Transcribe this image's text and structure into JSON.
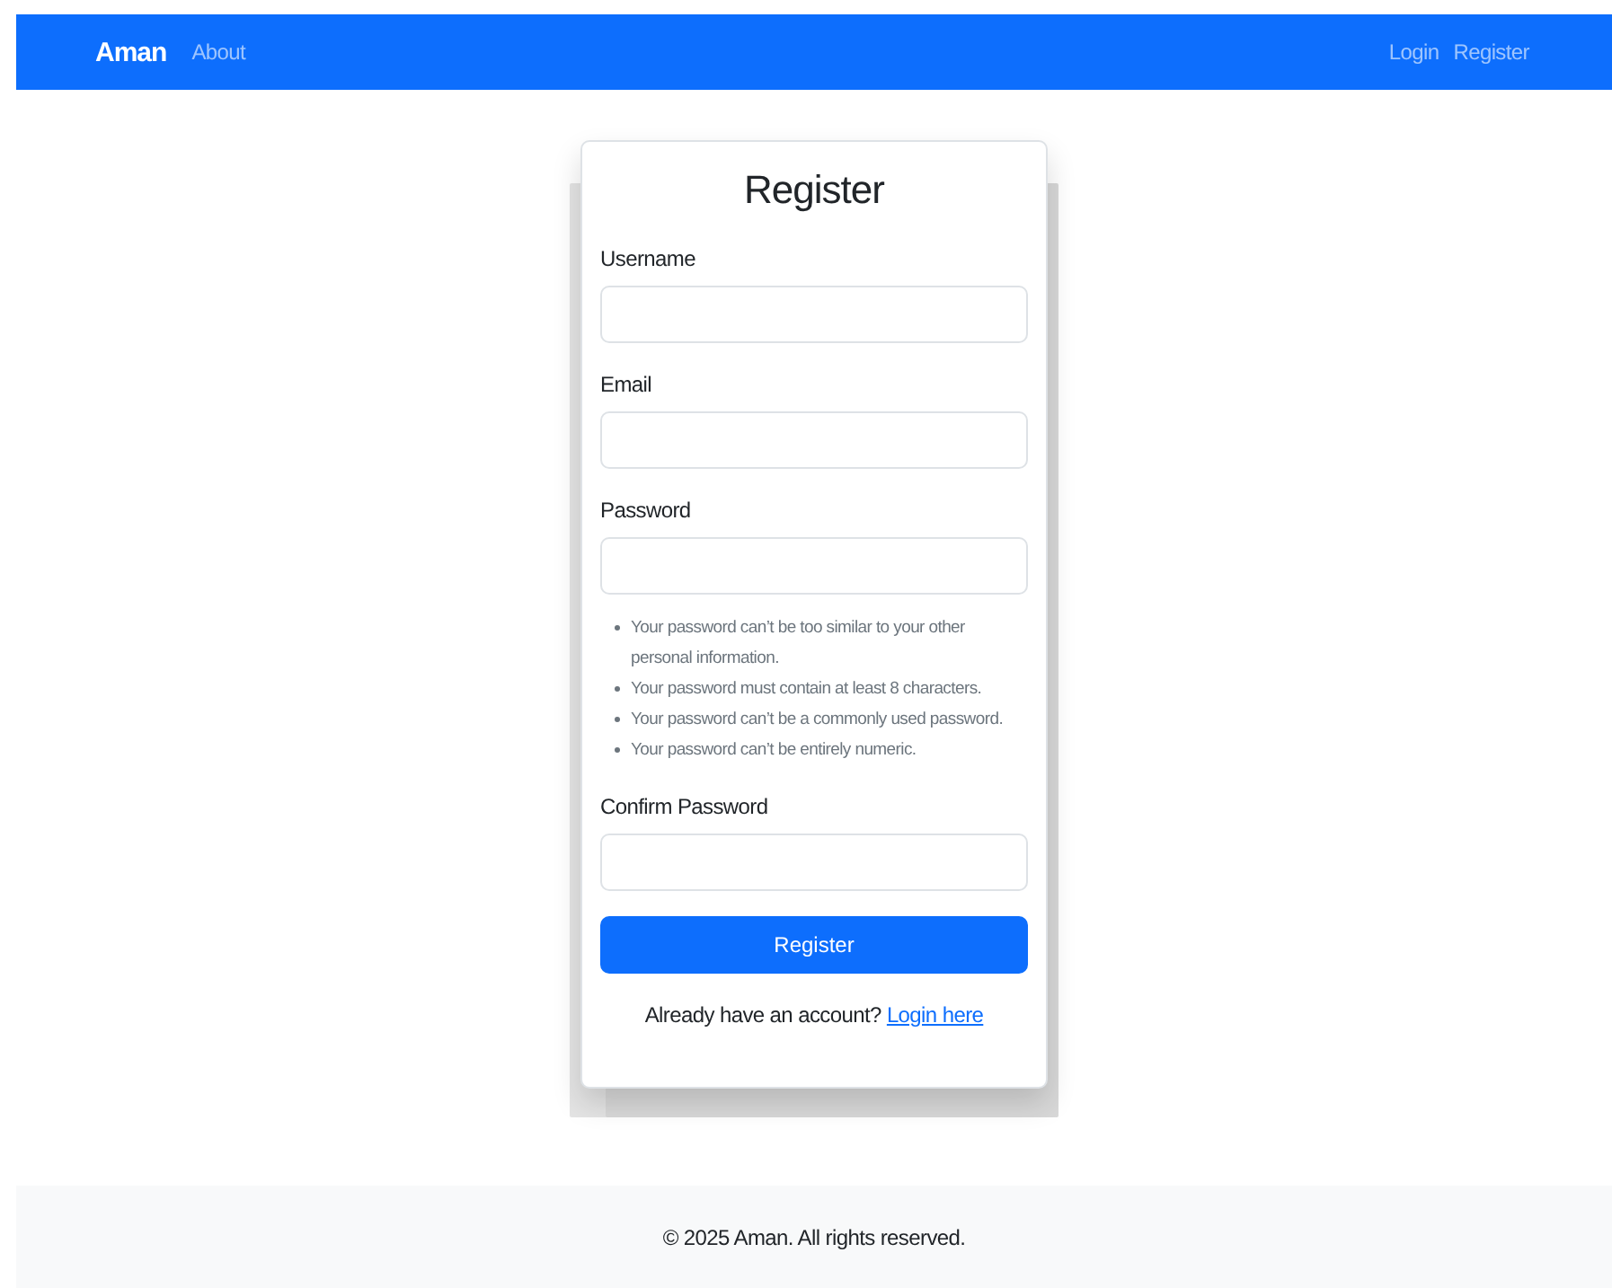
{
  "navbar": {
    "brand": "Aman",
    "links": [
      {
        "label": "About"
      }
    ],
    "right_links": [
      {
        "label": "Login"
      },
      {
        "label": "Register"
      }
    ]
  },
  "form": {
    "title": "Register",
    "fields": [
      {
        "label": "Username"
      },
      {
        "label": "Email"
      },
      {
        "label": "Password",
        "hints": [
          "Your password can’t be too similar to your other personal information.",
          "Your password must contain at least 8 characters.",
          "Your password can’t be a commonly used password.",
          "Your password can’t be entirely numeric."
        ]
      },
      {
        "label": "Confirm Password"
      }
    ],
    "submit": "Register",
    "footer_text": "Already have an account?",
    "footer_link": "Login here"
  },
  "footer": {
    "text": "© 2025 Aman. All rights reserved."
  }
}
